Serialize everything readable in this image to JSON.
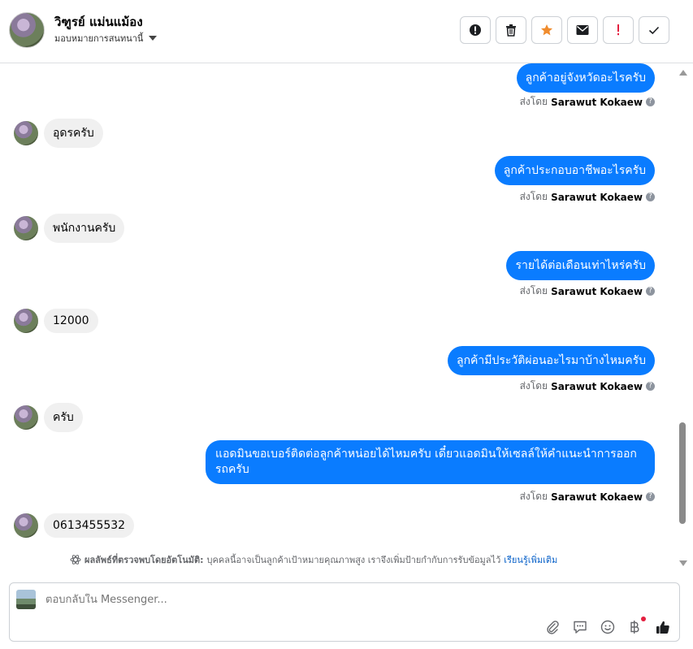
{
  "header": {
    "contact_name": "วิฑูรย์ แม่นแม้อง",
    "assign_label": "มอบหมายการสนทนานี้",
    "tools": [
      {
        "icon": "alert-icon"
      },
      {
        "icon": "trash-icon"
      },
      {
        "icon": "star-icon"
      },
      {
        "icon": "mail-icon"
      },
      {
        "icon": "exclamation-icon"
      },
      {
        "icon": "check-icon"
      }
    ]
  },
  "messages": [
    {
      "dir": "out",
      "text": "ลูกค้าอยู่จังหวัดอะไรครับ",
      "sent_by_prefix": "ส่งโดย",
      "sender": "Sarawut Kokaew"
    },
    {
      "dir": "in",
      "text": "อุดรครับ"
    },
    {
      "dir": "out",
      "text": "ลูกค้าประกอบอาชีพอะไรครับ",
      "sent_by_prefix": "ส่งโดย",
      "sender": "Sarawut Kokaew"
    },
    {
      "dir": "in",
      "text": "พนักงานครับ"
    },
    {
      "dir": "out",
      "text": "รายได้ต่อเดือนเท่าไหร่ครับ",
      "sent_by_prefix": "ส่งโดย",
      "sender": "Sarawut Kokaew"
    },
    {
      "dir": "in",
      "text": "12000"
    },
    {
      "dir": "out",
      "text": "ลูกค้ามีประวัติผ่อนอะไรมาบ้างไหมครับ",
      "sent_by_prefix": "ส่งโดย",
      "sender": "Sarawut Kokaew"
    },
    {
      "dir": "in",
      "text": "ครับ"
    },
    {
      "dir": "out",
      "text": "แอดมินขอเบอร์ติดต่อลูกค้าหน่อยได้ไหมครับ เดี๋ยวแอดมินให้เซลล์ให้คำแนะนำการออกรถครับ",
      "sent_by_prefix": "ส่งโดย",
      "sender": "Sarawut Kokaew"
    },
    {
      "dir": "in",
      "text": "0613455532"
    }
  ],
  "auto_note": {
    "bold": "ผลลัพธ์ที่ตรวจพบโดยอัตโนมัติ:",
    "text": "บุคคลนี้อาจเป็นลูกค้าเป้าหมายคุณภาพสูง เราจึงเพิ่มป้ายกำกับการรับข้อมูลไว้",
    "link": "เรียนรู้เพิ่มเติม"
  },
  "composer": {
    "placeholder": "ตอบกลับใน Messenger..."
  },
  "colors": {
    "outgoing_bubble": "#0a7cff",
    "incoming_bubble": "#f0f0f0",
    "star": "#f08c2e",
    "exclamation": "#e41e3f"
  }
}
